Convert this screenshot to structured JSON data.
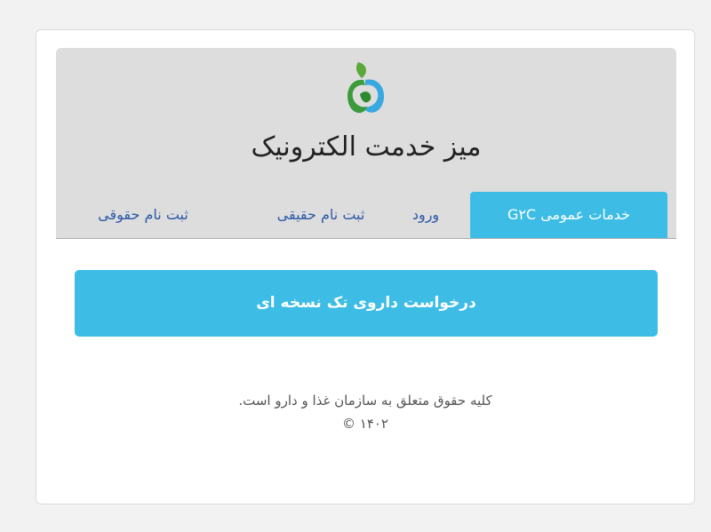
{
  "app": {
    "title": "میز خدمت الکترونیک",
    "logo": "fda-logo-icon"
  },
  "tabs": [
    {
      "label": "خدمات عمومی G۲C",
      "active": true
    },
    {
      "label": "ورود",
      "active": false
    },
    {
      "label": "ثبت نام حقیقی",
      "active": false
    },
    {
      "label": "ثبت نام حقوقی",
      "active": false
    }
  ],
  "main": {
    "action_label": "درخواست داروی تک نسخه ای"
  },
  "footer": {
    "copyright_text": "کلیه حقوق متعلق به سازمان غذا و دارو است.",
    "year": "۱۴۰۲",
    "copyright_symbol": "©"
  },
  "colors": {
    "accent": "#3dbde5",
    "header_bg": "#dddddd",
    "link": "#2d5aa8"
  }
}
